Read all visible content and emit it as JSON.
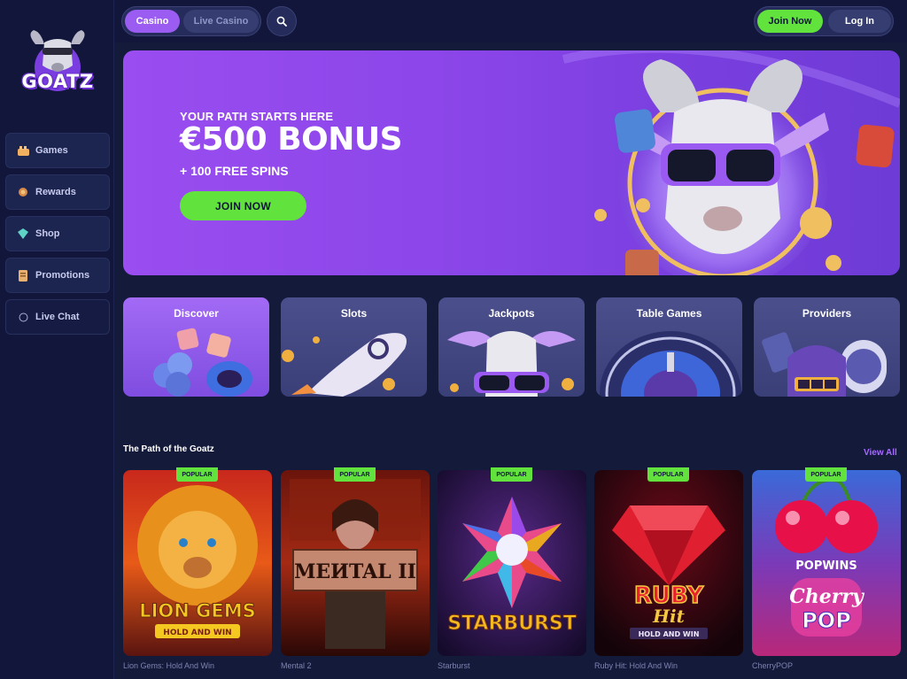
{
  "brand": {
    "name": "GOATZ",
    "accent": "#9b5cf2",
    "green": "#62e23c"
  },
  "sidebar": {
    "items": [
      {
        "label": "Games",
        "icon": "games-icon"
      },
      {
        "label": "Rewards",
        "icon": "rewards-icon"
      },
      {
        "label": "Shop",
        "icon": "shop-icon"
      },
      {
        "label": "Promotions",
        "icon": "promotions-icon"
      },
      {
        "label": "Live Chat",
        "icon": "chat-icon"
      }
    ]
  },
  "topbar": {
    "tabs": [
      {
        "label": "Casino",
        "active": true
      },
      {
        "label": "Live Casino",
        "active": false
      }
    ],
    "search_icon": "search-icon",
    "join_label": "Join Now",
    "login_label": "Log In"
  },
  "hero": {
    "tagline": "YOUR PATH STARTS HERE",
    "title": "€500 BONUS",
    "subtitle": "+ 100 FREE SPINS",
    "cta": "JOIN NOW"
  },
  "categories": [
    {
      "label": "Discover"
    },
    {
      "label": "Slots"
    },
    {
      "label": "Jackpots"
    },
    {
      "label": "Table Games"
    },
    {
      "label": "Providers"
    }
  ],
  "section": {
    "title": "The Path of the Goatz",
    "view_all": "View All"
  },
  "games": [
    {
      "badge": "POPULAR",
      "name": "Lion Gems: Hold And Win",
      "art_text": "LION GEMS",
      "art_sub": "HOLD AND WIN"
    },
    {
      "badge": "POPULAR",
      "name": "Mental 2",
      "art_text": "MEИTAL II",
      "art_sub": ""
    },
    {
      "badge": "POPULAR",
      "name": "Starburst",
      "art_text": "STARBURST",
      "art_sub": ""
    },
    {
      "badge": "POPULAR",
      "name": "Ruby Hit: Hold And Win",
      "art_text": "RUBY",
      "art_sub": "HOLD AND WIN",
      "art_text2": "Hit"
    },
    {
      "badge": "POPULAR",
      "name": "CherryPOP",
      "art_text": "POPWINS",
      "art_sub": "Cherry",
      "art_text2": "POP"
    }
  ]
}
